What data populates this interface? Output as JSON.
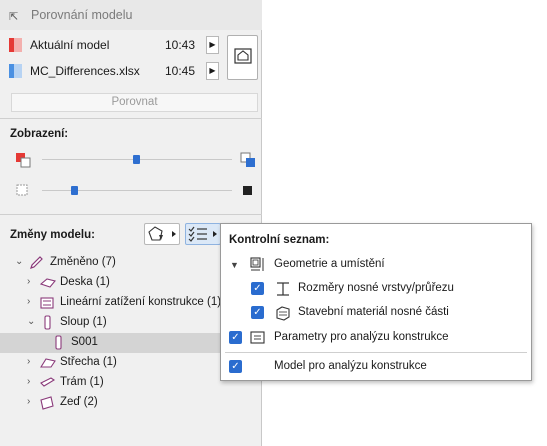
{
  "window": {
    "title": "Porovnání modelu"
  },
  "models": [
    {
      "name": "Aktuální model",
      "time": "10:43",
      "color": "#e53935"
    },
    {
      "name": "MC_Differences.xlsx",
      "time": "10:45",
      "color": "#4a90e2"
    }
  ],
  "compare_button": "Porovnat",
  "display": {
    "label": "Zobrazení:",
    "slider1_value": 0.62,
    "slider2_value": 0.22
  },
  "changes": {
    "label": "Změny modelu:"
  },
  "tree": [
    {
      "label": "Změněno (7)",
      "icon": "pencil-icon",
      "chevron": "down"
    },
    {
      "label": "Deska (1)",
      "icon": "slab-icon",
      "chevron": "right"
    },
    {
      "label": "Lineární zatížení konstrukce (1)",
      "icon": "line-load-icon",
      "chevron": "right"
    },
    {
      "label": "Sloup (1)",
      "icon": "column-icon",
      "chevron": "down"
    },
    {
      "label": "S001",
      "icon": "column-icon",
      "chevron": ""
    },
    {
      "label": "Střecha (1)",
      "icon": "roof-icon",
      "chevron": "right"
    },
    {
      "label": "Trám (1)",
      "icon": "beam-icon",
      "chevron": "right"
    },
    {
      "label": "Zeď (2)",
      "icon": "wall-icon",
      "chevron": "right"
    }
  ],
  "checklist": {
    "title": "Kontrolní seznam:",
    "items": [
      {
        "label": "Geometrie a umístění",
        "checked": null,
        "icon": "geometry-icon"
      },
      {
        "label": "Rozměry nosné vrstvy/průřezu",
        "checked": true,
        "icon": "dimension-icon"
      },
      {
        "label": "Stavební materiál nosné části",
        "checked": true,
        "icon": "material-icon"
      },
      {
        "label": "Parametry pro analýzu konstrukce",
        "checked": true,
        "icon": "parameters-icon"
      },
      {
        "label": "Model pro analýzu konstrukce",
        "checked": true,
        "icon": ""
      }
    ]
  },
  "colors": {
    "accent": "#2a6ccf",
    "selection": "#d4d4d4"
  }
}
